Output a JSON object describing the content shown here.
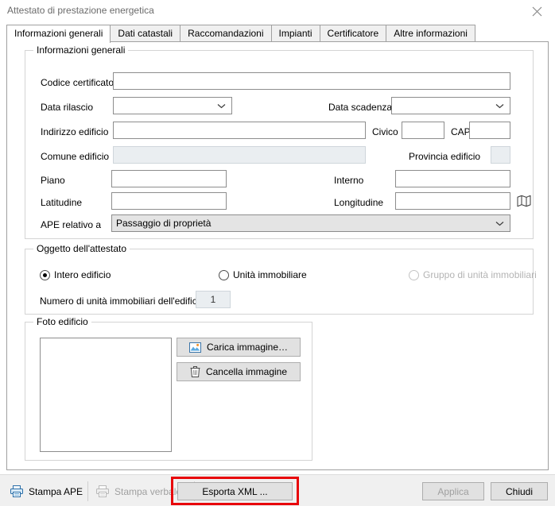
{
  "window": {
    "title": "Attestato di prestazione energetica",
    "close_icon": "close-icon"
  },
  "tabs": [
    {
      "label": "Informazioni generali",
      "active": true
    },
    {
      "label": "Dati catastali",
      "active": false
    },
    {
      "label": "Raccomandazioni",
      "active": false
    },
    {
      "label": "Impianti",
      "active": false
    },
    {
      "label": "Certificatore",
      "active": false
    },
    {
      "label": "Altre informazioni",
      "active": false
    }
  ],
  "groups": {
    "info": {
      "title": "Informazioni generali",
      "fields": {
        "codice_certificato": {
          "label": "Codice certificato",
          "value": ""
        },
        "data_rilascio": {
          "label": "Data rilascio",
          "value": ""
        },
        "data_scadenza": {
          "label": "Data scadenza",
          "value": ""
        },
        "indirizzo_edificio": {
          "label": "Indirizzo edificio",
          "value": ""
        },
        "civico": {
          "label": "Civico",
          "value": ""
        },
        "cap": {
          "label": "CAP",
          "value": ""
        },
        "comune_edificio": {
          "label": "Comune edificio",
          "value": ""
        },
        "provincia_edificio": {
          "label": "Provincia edificio",
          "value": ""
        },
        "piano": {
          "label": "Piano",
          "value": ""
        },
        "interno": {
          "label": "Interno",
          "value": ""
        },
        "latitudine": {
          "label": "Latitudine",
          "value": ""
        },
        "longitudine": {
          "label": "Longitudine",
          "value": ""
        },
        "ape_relativo_a": {
          "label": "APE relativo a",
          "value": "Passaggio di proprietà"
        }
      },
      "map_icon": "map-icon"
    },
    "oggetto": {
      "title": "Oggetto dell'attestato",
      "options": [
        {
          "label": "Intero edificio",
          "checked": true,
          "disabled": false
        },
        {
          "label": "Unità immobiliare",
          "checked": false,
          "disabled": false
        },
        {
          "label": "Gruppo di unità immobiliari",
          "checked": false,
          "disabled": true
        }
      ],
      "numero_unita": {
        "label": "Numero di unità immobiliari dell'edificio",
        "value": "1"
      }
    },
    "foto": {
      "title": "Foto edificio",
      "buttons": [
        {
          "label": "Carica immagine…",
          "icon": "image-icon"
        },
        {
          "label": "Cancella immagine",
          "icon": "trash-icon"
        }
      ]
    }
  },
  "footer": {
    "stampa_ape": {
      "label": "Stampa APE",
      "icon": "printer-icon",
      "disabled": false
    },
    "stampa_verbale": {
      "label": "Stampa verbale",
      "icon": "printer-icon",
      "disabled": true
    },
    "esporta_xml": {
      "label": "Esporta XML ...",
      "disabled": false,
      "highlighted": true
    },
    "applica": {
      "label": "Applica",
      "disabled": true
    },
    "chiudi": {
      "label": "Chiudi",
      "disabled": false
    }
  },
  "colors": {
    "highlight": "#e8060a",
    "accent": "#2a7fc9",
    "chrome": "#f0f0f0",
    "border": "#a0a0a0"
  }
}
